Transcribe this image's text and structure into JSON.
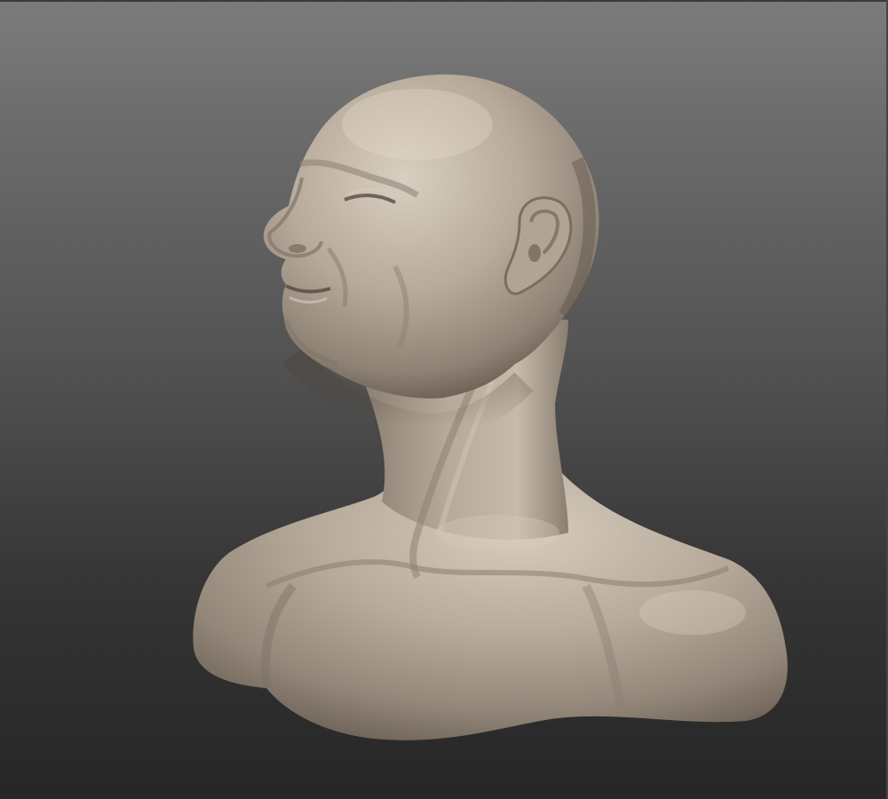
{
  "viewport": {
    "background_top": "#7b7b7b",
    "background_bottom": "#262626"
  },
  "model": {
    "material_color": "#b3a697",
    "shadow_color": "#6f6255",
    "highlight_color": "#d8cdbf"
  }
}
